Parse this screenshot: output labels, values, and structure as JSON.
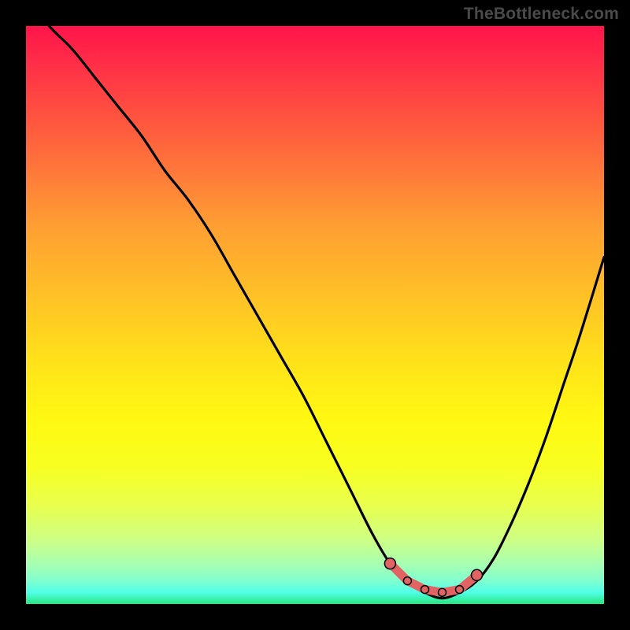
{
  "watermark": "TheBottleneck.com",
  "colors": {
    "frame": "#000000",
    "curve_stroke": "#000000",
    "marker_fill": "#e26363",
    "marker_stroke": "#000000"
  },
  "chart_data": {
    "type": "line",
    "title": "",
    "xlabel": "",
    "ylabel": "",
    "xlim": [
      0,
      100
    ],
    "ylim": [
      0,
      100
    ],
    "grid": false,
    "legend": false,
    "series": [
      {
        "name": "bottleneck_curve",
        "x": [
          0,
          4,
          8,
          12,
          16,
          20,
          24,
          28,
          32,
          36,
          40,
          44,
          48,
          52,
          56,
          60,
          63,
          66,
          69,
          72,
          75,
          78,
          81,
          84,
          87,
          90,
          93,
          96,
          100
        ],
        "values": [
          105,
          100,
          96,
          91,
          86,
          81,
          75,
          70,
          64,
          57,
          50,
          43,
          36,
          28,
          20,
          12,
          7,
          4,
          2,
          1,
          2,
          4,
          8,
          14,
          21,
          29,
          38,
          47,
          60
        ]
      }
    ],
    "markers": [
      {
        "x": 63,
        "y": 7
      },
      {
        "x": 66,
        "y": 4
      },
      {
        "x": 69,
        "y": 2.5
      },
      {
        "x": 72,
        "y": 2
      },
      {
        "x": 75,
        "y": 2.5
      },
      {
        "x": 78,
        "y": 5
      }
    ],
    "annotations": []
  }
}
